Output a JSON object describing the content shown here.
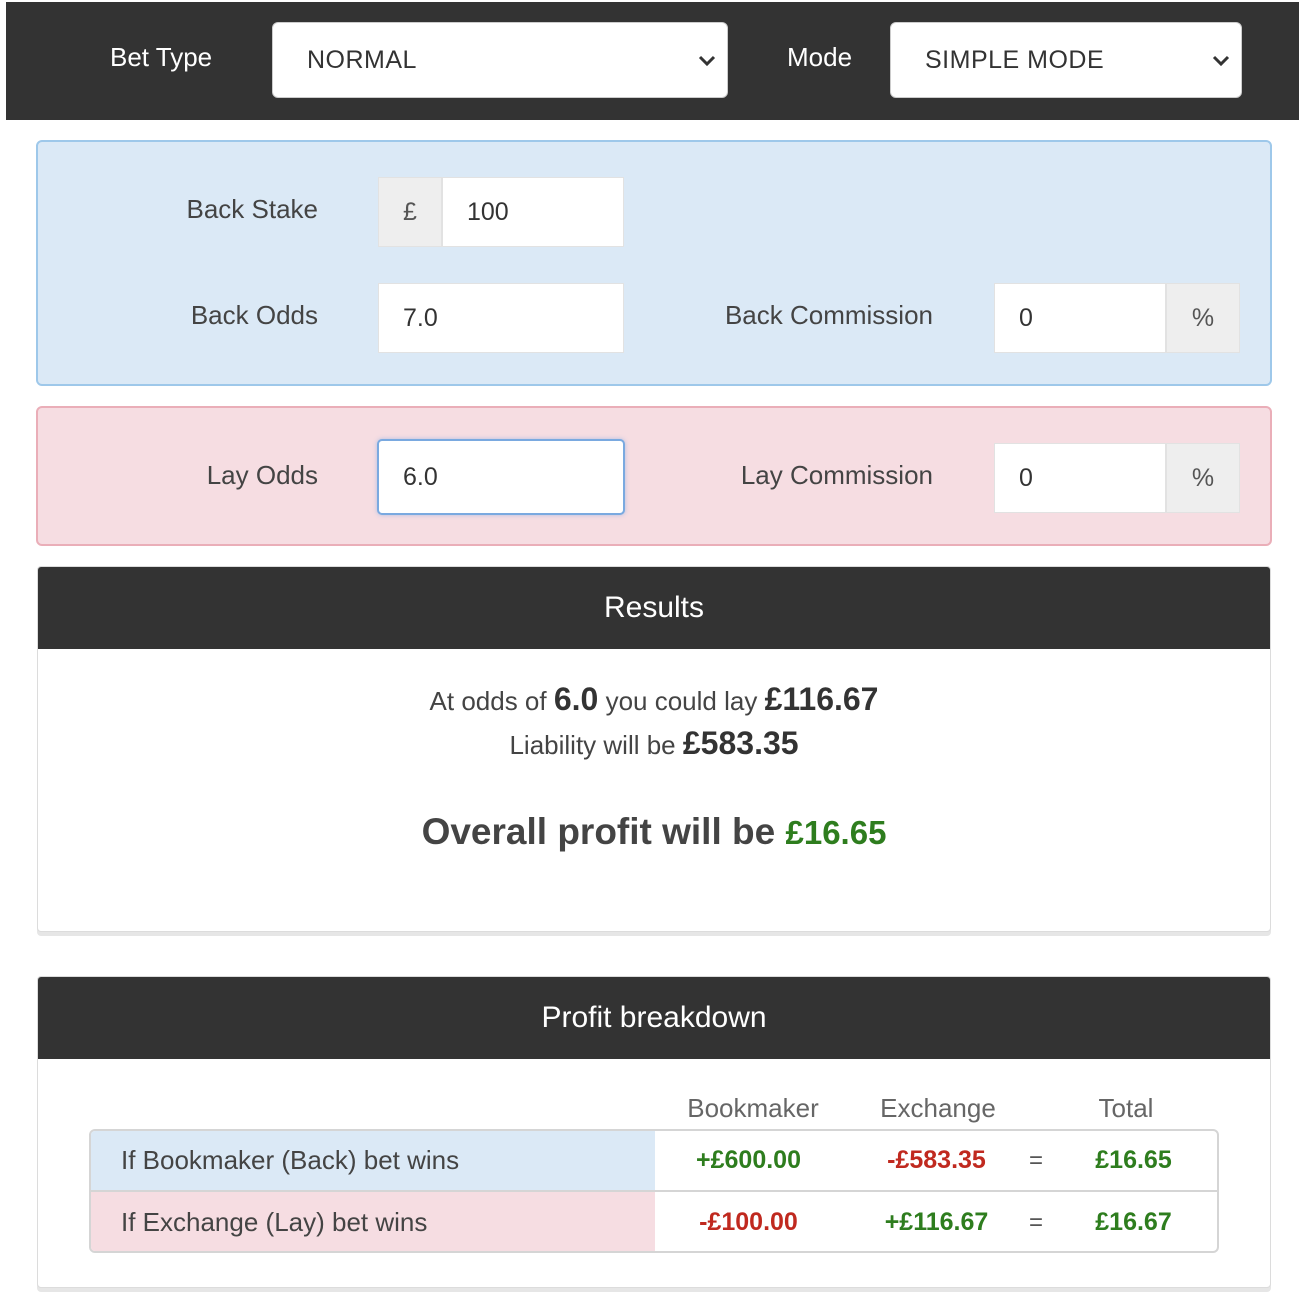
{
  "topbar": {
    "bet_type_label": "Bet Type",
    "bet_type_value": "NORMAL",
    "mode_label": "Mode",
    "mode_value": "SIMPLE MODE"
  },
  "back": {
    "stake_label": "Back Stake",
    "currency": "£",
    "stake_value": "100",
    "odds_label": "Back Odds",
    "odds_value": "7.0",
    "commission_label": "Back Commission",
    "commission_value": "0",
    "percent": "%"
  },
  "lay": {
    "odds_label": "Lay Odds",
    "odds_value": "6.0",
    "commission_label": "Lay Commission",
    "commission_value": "0",
    "percent": "%"
  },
  "results": {
    "title": "Results",
    "line1_pre": "At odds of",
    "line1_odds": "6.0",
    "line1_mid": "you could lay",
    "line1_amount": "£116.67",
    "line2_pre": "Liability will be",
    "line2_amount": "£583.35",
    "profit_pre": "Overall profit will be",
    "profit_amount": "£16.65",
    "colors": {
      "positive": "#2e7d1e",
      "negative": "#c0291f"
    }
  },
  "breakdown": {
    "title": "Profit breakdown",
    "columns": [
      "Bookmaker",
      "Exchange",
      "Total"
    ],
    "rows": [
      {
        "label": "If Bookmaker (Back) bet wins",
        "bookmaker": "+£600.00",
        "exchange": "-£583.35",
        "eq": "=",
        "total": "£16.65"
      },
      {
        "label": "If Exchange (Lay) bet wins",
        "bookmaker": "-£100.00",
        "exchange": "+£116.67",
        "eq": "=",
        "total": "£16.67"
      }
    ]
  }
}
